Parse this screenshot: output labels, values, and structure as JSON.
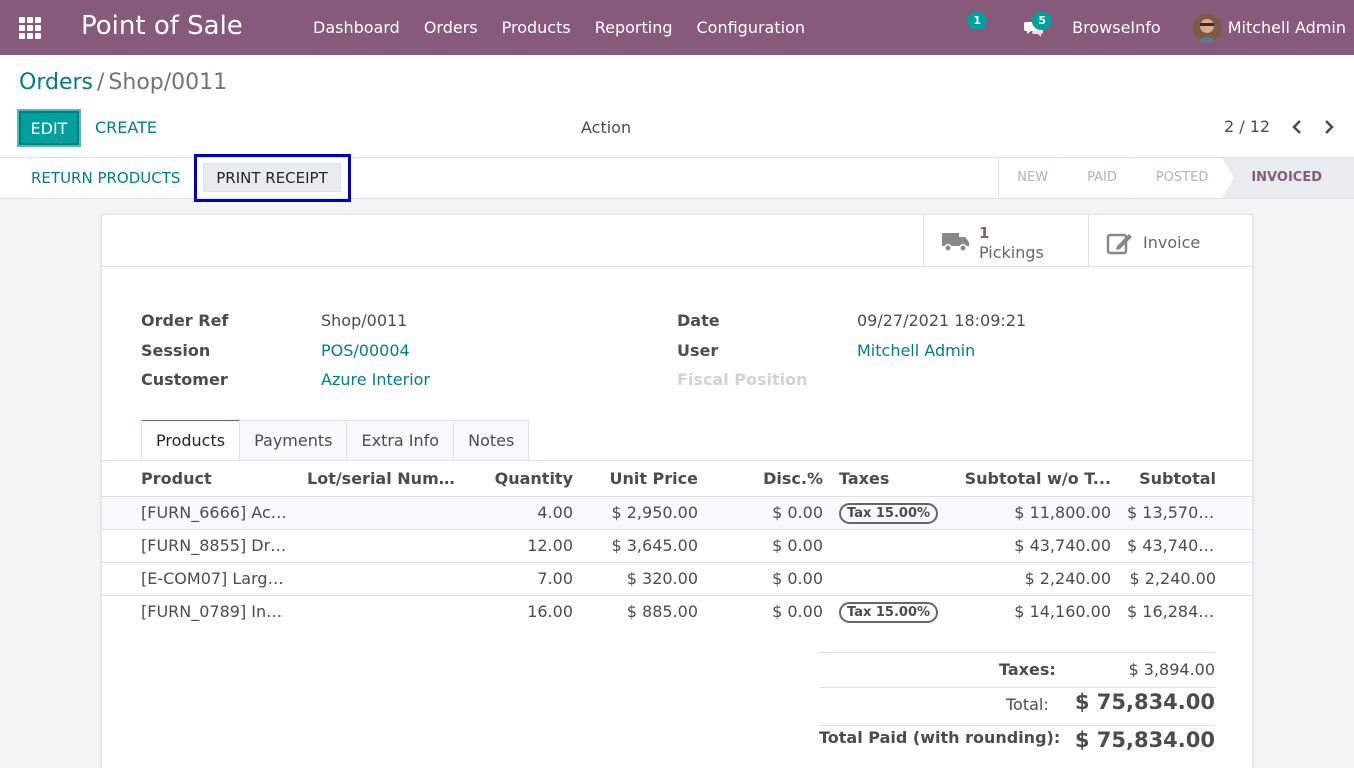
{
  "navbar": {
    "app_title": "Point of Sale",
    "menu": [
      "Dashboard",
      "Orders",
      "Products",
      "Reporting",
      "Configuration"
    ],
    "activity_count": "1",
    "messages_count": "5",
    "company": "BrowseInfo",
    "user": "Mitchell Admin"
  },
  "breadcrumb": {
    "parent": "Orders",
    "separator": "/",
    "current": "Shop/0011"
  },
  "buttons": {
    "edit": "EDIT",
    "create": "CREATE",
    "action": "Action"
  },
  "pager": {
    "value": "2 / 12"
  },
  "statusbar": {
    "return_products": "RETURN PRODUCTS",
    "print_receipt": "PRINT RECEIPT",
    "stages": [
      "NEW",
      "PAID",
      "POSTED",
      "INVOICED"
    ],
    "current_stage": "INVOICED"
  },
  "smart_buttons": {
    "pickings_count": "1",
    "pickings_label": "Pickings",
    "invoice_label": "Invoice"
  },
  "fields": {
    "order_ref_label": "Order Ref",
    "order_ref": "Shop/0011",
    "session_label": "Session",
    "session": "POS/00004",
    "customer_label": "Customer",
    "customer": "Azure Interior",
    "date_label": "Date",
    "date": "09/27/2021 18:09:21",
    "user_label": "User",
    "user": "Mitchell Admin",
    "fiscal_position_label": "Fiscal Position"
  },
  "tabs": [
    "Products",
    "Payments",
    "Extra Info",
    "Notes"
  ],
  "table": {
    "headers": [
      "Product",
      "Lot/serial Number",
      "Quantity",
      "Unit Price",
      "Disc.%",
      "Taxes",
      "Subtotal w/o T...",
      "Subtotal"
    ],
    "rows": [
      {
        "product": "[FURN_6666] Aco...",
        "lot": "",
        "qty": "4.00",
        "price": "$ 2,950.00",
        "disc": "$ 0.00",
        "tax": "Tax 15.00%",
        "subtotal_wo": "$ 11,800.00",
        "subtotal": "$ 13,570...."
      },
      {
        "product": "[FURN_8855] Dra...",
        "lot": "",
        "qty": "12.00",
        "price": "$ 3,645.00",
        "disc": "$ 0.00",
        "tax": "",
        "subtotal_wo": "$ 43,740.00",
        "subtotal": "$ 43,740...."
      },
      {
        "product": "[E-COM07] Large ...",
        "lot": "",
        "qty": "7.00",
        "price": "$ 320.00",
        "disc": "$ 0.00",
        "tax": "",
        "subtotal_wo": "$ 2,240.00",
        "subtotal": "$ 2,240.00"
      },
      {
        "product": "[FURN_0789] Indi...",
        "lot": "",
        "qty": "16.00",
        "price": "$ 885.00",
        "disc": "$ 0.00",
        "tax": "Tax 15.00%",
        "subtotal_wo": "$ 14,160.00",
        "subtotal": "$ 16,284...."
      }
    ]
  },
  "totals": {
    "taxes_label": "Taxes:",
    "taxes": "$ 3,894.00",
    "total_label": "Total:",
    "total": "$ 75,834.00",
    "paid_label": "Total Paid (with rounding):",
    "paid": "$ 75,834.00"
  },
  "colors": {
    "brand": "#875a7b",
    "accent": "#00a09d",
    "link": "#017e84",
    "highlight": "#0000cc"
  }
}
